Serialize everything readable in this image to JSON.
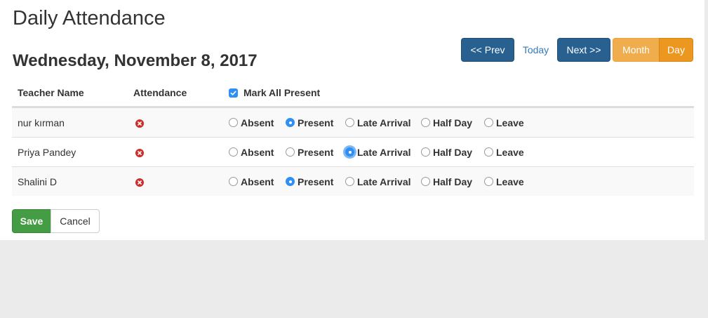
{
  "page": {
    "title": "Daily Attendance",
    "date": "Wednesday, November 8, 2017"
  },
  "nav": {
    "prev": "<< Prev",
    "today": "Today",
    "next": "Next >>",
    "month": "Month",
    "day": "Day"
  },
  "table": {
    "headers": {
      "name": "Teacher Name",
      "attendance": "Attendance",
      "mark_all": "Mark All Present"
    },
    "options": [
      "Absent",
      "Present",
      "Late Arrival",
      "Half Day",
      "Leave"
    ],
    "rows": [
      {
        "name": "nur kırman",
        "selected": "Present"
      },
      {
        "name": "Priya Pandey",
        "selected": "Late Arrival"
      },
      {
        "name": "Shalini D",
        "selected": "Present"
      }
    ]
  },
  "actions": {
    "save": "Save",
    "cancel": "Cancel"
  },
  "colors": {
    "primary": "#286090",
    "warning": "#f0ad4e",
    "success": "#449d44",
    "danger": "#c9302c",
    "radio_checked": "#2f8ff4"
  }
}
